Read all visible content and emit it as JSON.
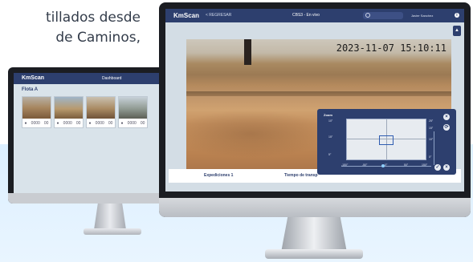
{
  "intro": {
    "line1": "tillados desde",
    "line2": "de Caminos,"
  },
  "back_app": {
    "logo": "KmScan",
    "header_title": "Dashboard",
    "section_title": "Flota A",
    "cards": [
      {
        "stats": [
          "",
          "0000",
          "00"
        ]
      },
      {
        "stats": [
          "",
          "0000",
          "00"
        ]
      },
      {
        "stats": [
          "",
          "0000",
          "00"
        ]
      },
      {
        "stats": [
          "",
          "0000",
          "00"
        ]
      }
    ]
  },
  "front_app": {
    "logo": "KmScan",
    "back_link": "< REGRESAR",
    "title": "CBS3 - En vivo",
    "user_name": "Javier Sanchez",
    "info_icon": "info-icon",
    "camera": {
      "timestamp": "2023-11-07  15:10:11"
    },
    "tabs": [
      "Expediciones 1",
      "Tiempo de transp"
    ],
    "ptz": {
      "title": "Zoom",
      "y_labels": [
        "10°",
        "15°",
        "5°"
      ],
      "x_labels": [
        "-150°",
        "-50°",
        "0°",
        "50°",
        "150°"
      ],
      "right_labels": [
        "25°",
        "15°",
        "10°",
        "0°"
      ],
      "buttons": [
        "×",
        "⟳",
        "✓",
        "×"
      ]
    }
  },
  "colors": {
    "brand_navy": "#2d3f6e",
    "band_blue": "#dcefff"
  }
}
